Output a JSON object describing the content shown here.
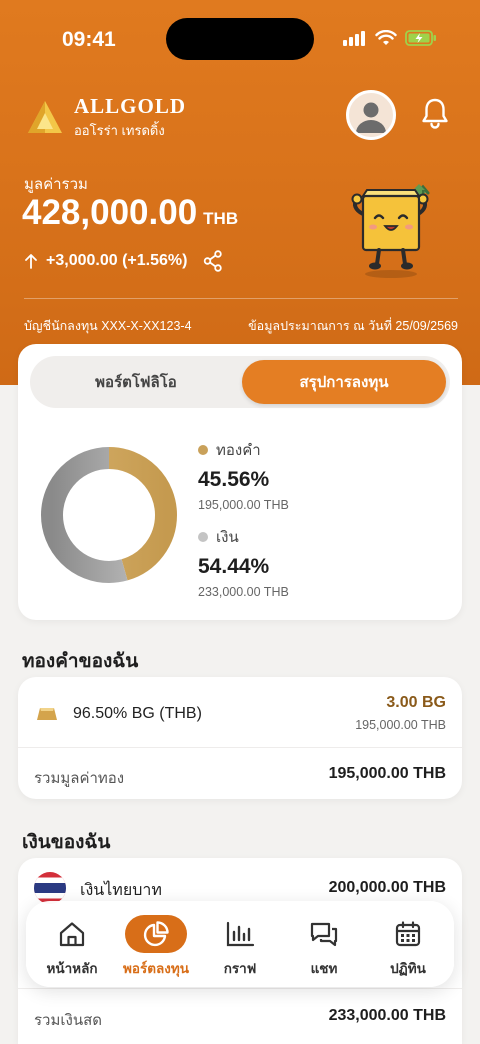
{
  "status_bar": {
    "time": "09:41"
  },
  "brand": {
    "name": "ALLGOLD",
    "subtitle": "ออโรร่า เทรดดิ้ง"
  },
  "summary": {
    "label": "มูลค่ารวม",
    "value": "428,000.00",
    "currency": "THB",
    "change": "+3,000.00 (+1.56%)",
    "account": "บัญชีนักลงทุน XXX-X-XX123-4",
    "as_of": "ข้อมูลประมาณการ ณ วันที่ 25/09/2569"
  },
  "tabs": {
    "portfolio": "พอร์ตโฟลิโอ",
    "summary": "สรุปการลงทุน"
  },
  "allocation": [
    {
      "name": "ทองคำ",
      "pct": "45.56%",
      "amount": "195,000.00 THB",
      "color": "#c9a15a",
      "fraction": 0.4556
    },
    {
      "name": "เงิน",
      "pct": "54.44%",
      "amount": "233,000.00 THB",
      "color": "#b8b8b8",
      "fraction": 0.5444
    }
  ],
  "gold_section": {
    "title": "ทองคำของฉัน",
    "item_name": "96.50% BG (THB)",
    "item_qty": "3.00 BG",
    "item_value": "195,000.00 THB",
    "total_label": "รวมมูลค่าทอง",
    "total_value": "195,000.00 THB"
  },
  "cash_section": {
    "title": "เงินของฉัน",
    "item_name": "เงินไทยบาท",
    "item_value": "200,000.00 THB",
    "total_label": "รวมเงินสด",
    "total_value": "233,000.00 THB"
  },
  "nav": {
    "home": "หน้าหลัก",
    "portfolio": "พอร์ตลงทุน",
    "graph": "กราฟ",
    "chat": "แชท",
    "calendar": "ปฏิทิน"
  },
  "colors": {
    "brand_orange": "#e07a1f",
    "active_tab": "#e47e23",
    "gold": "#c9a15a",
    "gold_qty": "#8a5a1a"
  }
}
